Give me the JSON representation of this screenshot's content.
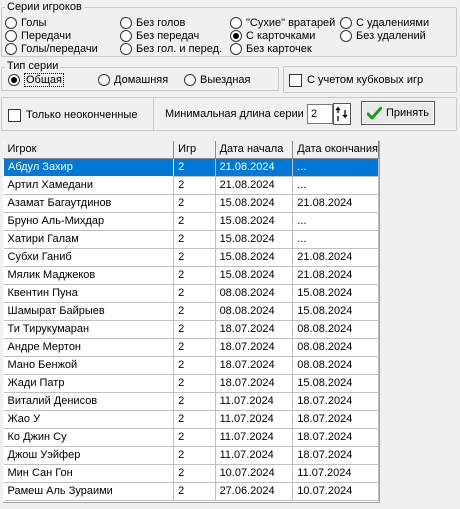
{
  "series_group": {
    "title": "Серии игроков",
    "options": [
      {
        "label": "Голы",
        "selected": false
      },
      {
        "label": "Передачи",
        "selected": false
      },
      {
        "label": "Голы/передачи",
        "selected": false
      },
      {
        "label": "Без голов",
        "selected": false
      },
      {
        "label": "Без передач",
        "selected": false
      },
      {
        "label": "Без гол. и перед.",
        "selected": false
      },
      {
        "label": "\"Сухие\" вратарей",
        "selected": false
      },
      {
        "label": "С карточками",
        "selected": true
      },
      {
        "label": "Без карточек",
        "selected": false
      },
      {
        "label": "С удалениями",
        "selected": false
      },
      {
        "label": "Без удалений",
        "selected": false
      }
    ]
  },
  "type_group": {
    "title": "Тип серии",
    "options": [
      {
        "label": "Общая",
        "selected": true
      },
      {
        "label": "Домашняя",
        "selected": false
      },
      {
        "label": "Выездная",
        "selected": false
      }
    ]
  },
  "cup_games_checkbox": {
    "label": "С учетом кубковых игр",
    "checked": false
  },
  "only_unfinished_checkbox": {
    "label": "Только неоконченные",
    "checked": false
  },
  "min_length": {
    "label": "Минимальная длина серии",
    "value": "2"
  },
  "apply_button": {
    "label": "Принять"
  },
  "table": {
    "columns": [
      "Игрок",
      "Игр",
      "Дата начала",
      "Дата окончания"
    ],
    "rows": [
      [
        "Абдул Захир",
        "2",
        "21.08.2024",
        "..."
      ],
      [
        "Артил Хамедани",
        "2",
        "21.08.2024",
        "..."
      ],
      [
        "Азамат Багаутдинов",
        "2",
        "15.08.2024",
        "21.08.2024"
      ],
      [
        "Бруно Аль-Михдар",
        "2",
        "15.08.2024",
        "..."
      ],
      [
        "Хатири Галам",
        "2",
        "15.08.2024",
        "..."
      ],
      [
        "Субхи Ганиб",
        "2",
        "15.08.2024",
        "21.08.2024"
      ],
      [
        "Мялик Маджеков",
        "2",
        "15.08.2024",
        "21.08.2024"
      ],
      [
        "Квентин Пуна",
        "2",
        "08.08.2024",
        "15.08.2024"
      ],
      [
        "Шамырат Байрыев",
        "2",
        "08.08.2024",
        "15.08.2024"
      ],
      [
        "Ти Тирукумаран",
        "2",
        "18.07.2024",
        "08.08.2024"
      ],
      [
        "Андре Мертон",
        "2",
        "18.07.2024",
        "08.08.2024"
      ],
      [
        "Мано Бенжой",
        "2",
        "18.07.2024",
        "08.08.2024"
      ],
      [
        "Жади Патр",
        "2",
        "18.07.2024",
        "15.08.2024"
      ],
      [
        "Виталий Денисов",
        "2",
        "11.07.2024",
        "18.07.2024"
      ],
      [
        "Жао У",
        "2",
        "11.07.2024",
        "18.07.2024"
      ],
      [
        "Ко Джин Су",
        "2",
        "11.07.2024",
        "18.07.2024"
      ],
      [
        "Джош Уэйфер",
        "2",
        "11.07.2024",
        "18.07.2024"
      ],
      [
        "Мин Сан Гон",
        "2",
        "10.07.2024",
        "11.07.2024"
      ],
      [
        "Рамеш Аль Зураими",
        "2",
        "27.06.2024",
        "10.07.2024"
      ]
    ],
    "selected_row": 0
  }
}
